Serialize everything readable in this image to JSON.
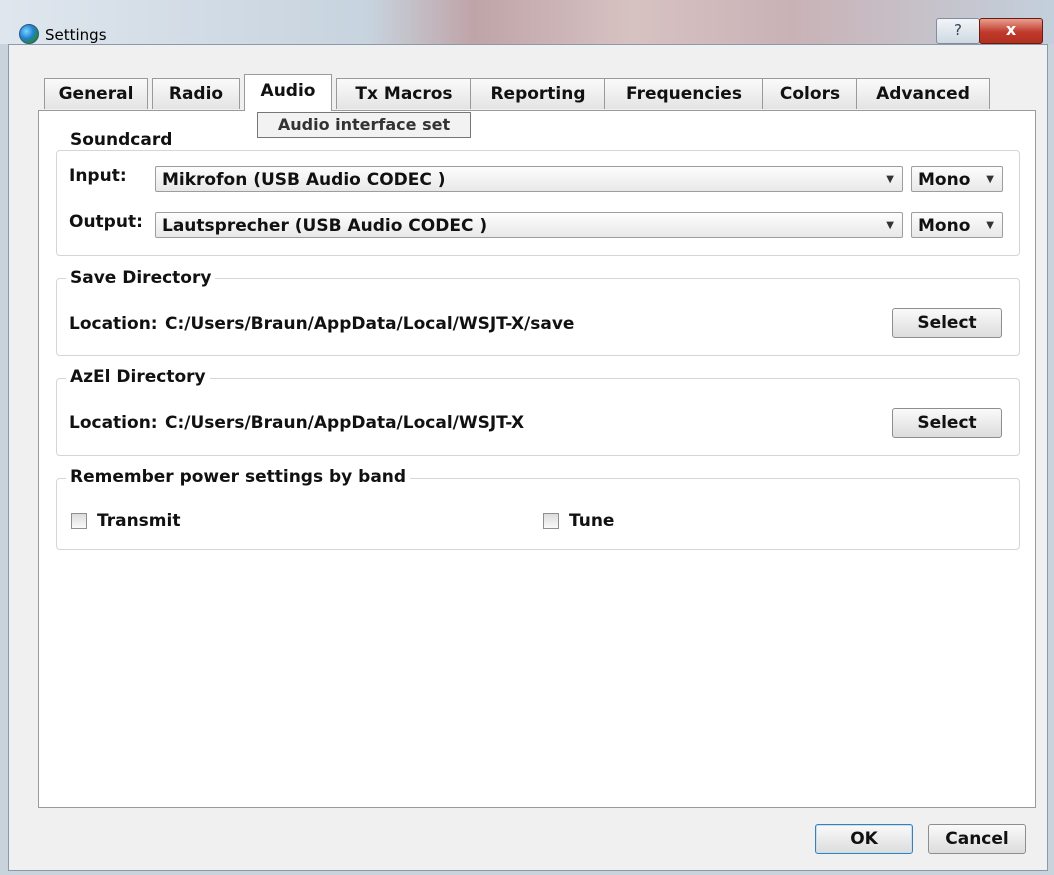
{
  "window": {
    "title": "Settings",
    "help_label": "?",
    "close_label": "x"
  },
  "tabs": [
    {
      "label": "General",
      "underline": "l",
      "active": false
    },
    {
      "label": "Radio",
      "underline": "R",
      "active": false
    },
    {
      "label": "Audio",
      "underline": "u",
      "active": true
    },
    {
      "label": "Tx Macros",
      "underline": "M",
      "active": false
    },
    {
      "label": "Reporting",
      "underline": "",
      "active": false
    },
    {
      "label": "Frequencies",
      "underline": "",
      "active": false
    },
    {
      "label": "Colors",
      "underline": "",
      "active": false
    },
    {
      "label": "Advanced",
      "underline": "",
      "active": false
    }
  ],
  "tooltip": "Audio interface set",
  "soundcard": {
    "title": "Soundcard",
    "input_label": "Input:",
    "input_value": "Mikrofon (USB Audio CODEC )",
    "input_channel": "Mono",
    "output_label": "Output:",
    "output_value": "Lautsprecher (USB Audio CODEC )",
    "output_channel": "Mono"
  },
  "save_dir": {
    "title": "Save Directory",
    "location_label": "Location:",
    "path": "C:/Users/Braun/AppData/Local/WSJT-X/save",
    "select_label": "Select"
  },
  "azel_dir": {
    "title": "AzEl Directory",
    "location_label": "Location:",
    "path": "C:/Users/Braun/AppData/Local/WSJT-X",
    "select_label": "Select"
  },
  "power": {
    "title": "Remember power settings by band",
    "transmit_label": "Transmit",
    "transmit_checked": false,
    "tune_label": "Tune",
    "tune_checked": false
  },
  "footer": {
    "ok_label": "OK",
    "cancel_label": "Cancel"
  }
}
